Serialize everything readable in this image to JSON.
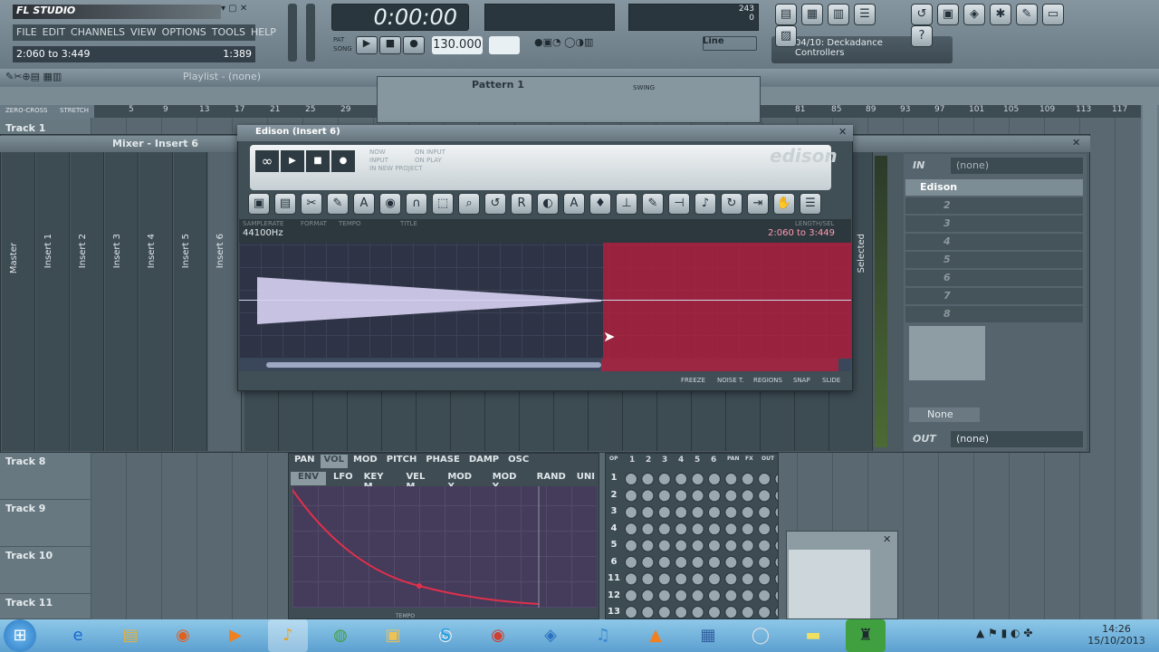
{
  "app": {
    "logo": "FL STUDIO",
    "menu": [
      "FILE",
      "EDIT",
      "CHANNELS",
      "VIEW",
      "OPTIONS",
      "TOOLS",
      "HELP"
    ],
    "hint": "2:060 to 3:449",
    "hint_right": "1:389"
  },
  "transport": {
    "time": "0:00:00",
    "tempo": "130.000",
    "snap": "Line",
    "pat_label": "PAT",
    "song_label": "SONG"
  },
  "cpu": {
    "mem": "243",
    "val": "0"
  },
  "preset": {
    "line1": "04/10: Deckadance",
    "line2": "Controllers"
  },
  "playlist": {
    "title": "Playlist - (none)",
    "ruler": [
      "5",
      "9",
      "13",
      "17",
      "21",
      "25",
      "29",
      "81",
      "85",
      "89",
      "93",
      "97",
      "101",
      "105",
      "109",
      "113",
      "117"
    ],
    "zero": "ZERO-CROSS",
    "stretch": "STRETCH"
  },
  "pattern": {
    "label": "Pattern 1",
    "swing": "SWING"
  },
  "tracks": [
    "Track 1",
    "Track 8",
    "Track 9",
    "Track 10",
    "Track 11"
  ],
  "mixer": {
    "title": "Mixer - Insert 6",
    "strips": [
      "Master",
      "Insert 1",
      "Insert 2",
      "Insert 3",
      "Insert 4",
      "Insert 5",
      "Insert 6"
    ],
    "selected": "Selected",
    "in_label": "IN",
    "in_value": "(none)",
    "out_label": "OUT",
    "out_value": "(none)",
    "slots": [
      "Edison",
      "2",
      "3",
      "4",
      "5",
      "6",
      "7",
      "8"
    ],
    "eq_value": "None"
  },
  "edison": {
    "title": "Edison (Insert 6)",
    "logo": "edison",
    "opt1": "NOW",
    "opt2": "INPUT",
    "opt3": "ON INPUT",
    "opt4": "ON PLAY",
    "opt5": "IN NEW PROJECT",
    "samplerate": "44100Hz",
    "range": "2:060 to 3:449",
    "col_samplerate": "SAMPLERATE",
    "col_format": "FORMAT",
    "col_tempo": "TEMPO",
    "col_title": "TITLE",
    "col_length": "LENGTH/SEL",
    "bottom": [
      "FREEZE",
      "NOISE T.",
      "REGIONS",
      "SNAP",
      "SLIDE"
    ]
  },
  "envelope": {
    "tabs": [
      "PAN",
      "VOL",
      "MOD",
      "PITCH",
      "PHASE",
      "DAMP",
      "OSC"
    ],
    "subtabs": [
      "ENV",
      "LFO",
      "KEY M",
      "VEL M",
      "MOD X",
      "MOD Y",
      "RAND",
      "UNI"
    ],
    "tempo": "TEMPO"
  },
  "matrix": {
    "header": [
      "OP",
      "1",
      "2",
      "3",
      "4",
      "5",
      "6",
      "PAN",
      "FX",
      "OUT"
    ],
    "rows": [
      "1",
      "2",
      "3",
      "4",
      "5",
      "6",
      "11",
      "12",
      "13"
    ]
  },
  "taskbar": {
    "time": "14:26",
    "date": "15/10/2013"
  }
}
